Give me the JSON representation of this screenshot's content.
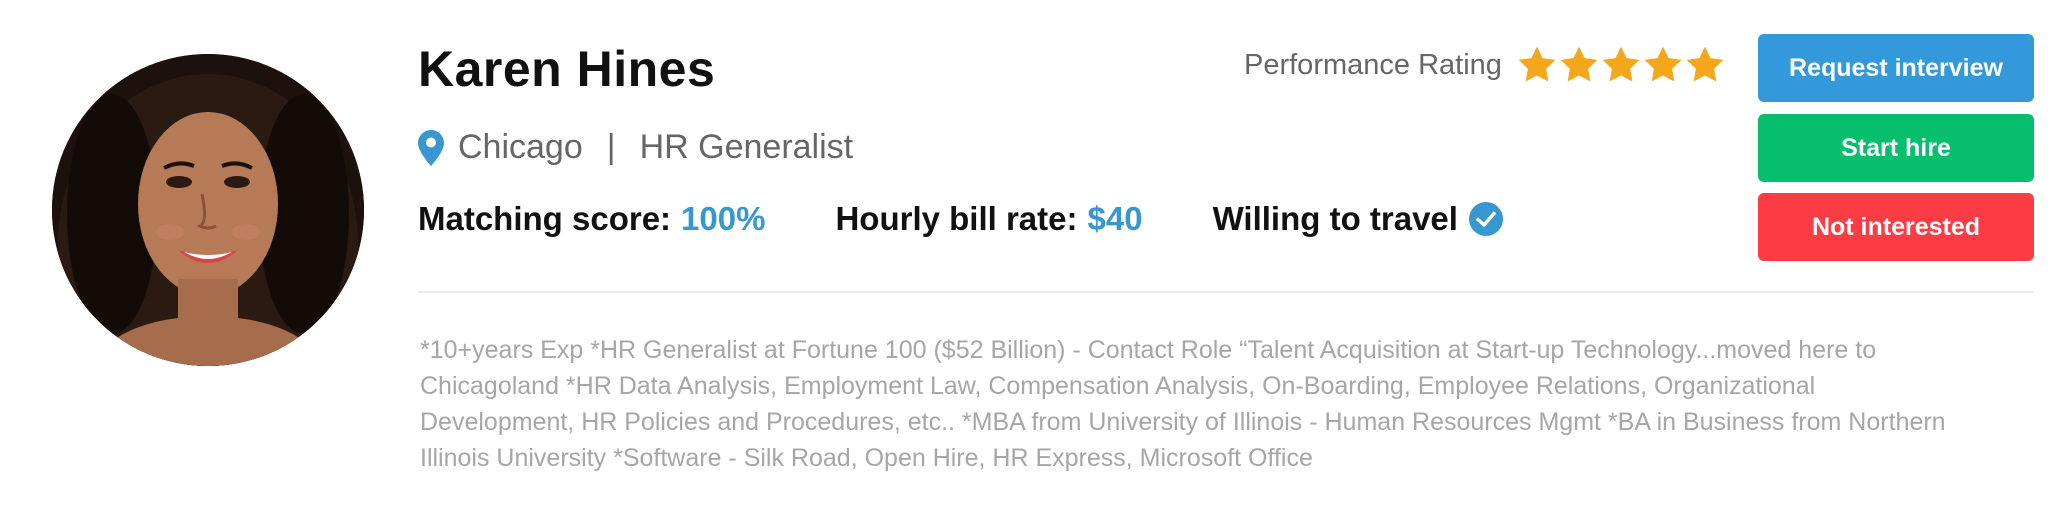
{
  "profile": {
    "name": "Karen Hines",
    "location": "Chicago",
    "separator": "|",
    "role": "HR Generalist"
  },
  "stats": {
    "matching_label": "Matching score:",
    "matching_value": "100%",
    "rate_label": "Hourly bill rate:",
    "rate_value": "$40",
    "travel_label": "Willing to travel"
  },
  "rating": {
    "label": "Performance Rating",
    "stars": 5,
    "max_stars": 5
  },
  "actions": {
    "request_label": "Request interview",
    "hire_label": "Start hire",
    "decline_label": "Not interested"
  },
  "bio": "*10+years Exp *HR Generalist at Fortune 100  ($52 Billion) - Contact Role “Talent Acquisition at Start-up Technology...moved here to Chicagoland *HR Data Analysis, Employment Law, Compensation Analysis, On-Boarding, Employee Relations, Organizational Development, HR Policies and Procedures, etc.. *MBA from University of Illinois - Human Resources Mgmt *BA in Business from Northern Illinois University *Software - Silk Road, Open Hire, HR Express, Microsoft Office",
  "icons": {
    "location": "map-pin-icon",
    "travel": "verified-check-icon",
    "star": "star-icon"
  },
  "colors": {
    "accent_blue": "#3797d1",
    "star": "#f5a71b",
    "button_blue": "#3399db",
    "button_green": "#05bf6c",
    "button_red": "#fc3c45"
  }
}
